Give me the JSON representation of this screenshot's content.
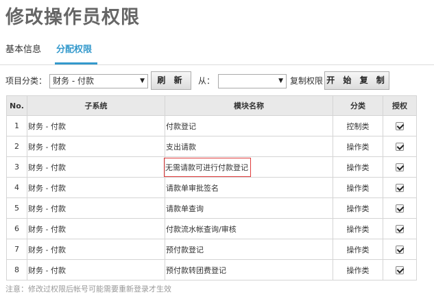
{
  "page": {
    "title": "修改操作员权限"
  },
  "tabs": {
    "basic": "基本信息",
    "permissions": "分配权限"
  },
  "toolbar": {
    "category_label": "项目分类：",
    "category_value": "财务 - 付款",
    "refresh_label": "刷 新",
    "from_label": "从：",
    "from_value": "",
    "copy_label": "复制权限",
    "start_copy_label": "开 始 复 制"
  },
  "table": {
    "headers": {
      "no": "No.",
      "subsystem": "子系统",
      "module": "模块名称",
      "type": "分类",
      "auth": "授权"
    },
    "rows": [
      {
        "no": "1",
        "subsystem": "财务 - 付款",
        "module": "付款登记",
        "type": "控制类",
        "checked": true
      },
      {
        "no": "2",
        "subsystem": "财务 - 付款",
        "module": "支出请款",
        "type": "操作类",
        "checked": true
      },
      {
        "no": "3",
        "subsystem": "财务 - 付款",
        "module": "无需请款可进行付款登记",
        "type": "操作类",
        "checked": true
      },
      {
        "no": "4",
        "subsystem": "财务 - 付款",
        "module": "请款单审批签名",
        "type": "操作类",
        "checked": true
      },
      {
        "no": "5",
        "subsystem": "财务 - 付款",
        "module": "请款单查询",
        "type": "操作类",
        "checked": true
      },
      {
        "no": "6",
        "subsystem": "财务 - 付款",
        "module": "付款流水帐查询/审核",
        "type": "操作类",
        "checked": true
      },
      {
        "no": "7",
        "subsystem": "财务 - 付款",
        "module": "预付款登记",
        "type": "操作类",
        "checked": true
      },
      {
        "no": "8",
        "subsystem": "财务 - 付款",
        "module": "预付款转团费登记",
        "type": "操作类",
        "checked": true
      }
    ]
  },
  "note": "注意：修改过权限后帐号可能需要重新登录才生效",
  "colors": {
    "accent": "#3399cc",
    "highlight_border": "#e03a3a"
  }
}
